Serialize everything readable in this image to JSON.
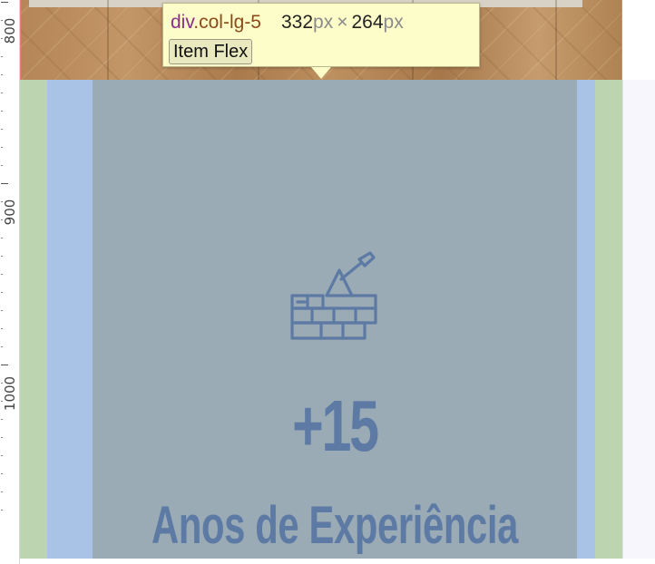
{
  "ruler": {
    "labels": [
      {
        "name": "ruler-label-800",
        "text": "800"
      },
      {
        "name": "ruler-label-900",
        "text": "900"
      },
      {
        "name": "ruler-label-1000",
        "text": "1000"
      }
    ]
  },
  "tooltip": {
    "tag": "div",
    "class_name": ".col-lg-5",
    "width_value": "332",
    "height_value": "264",
    "unit": "px",
    "times": "×",
    "badge": "Item Flex"
  },
  "stat": {
    "counter": "+15",
    "caption": "Anos de Experiência",
    "icon": "brick-wall-trowel-icon"
  },
  "colors": {
    "margin": "#bcd5b0",
    "padding": "#a8c3e6",
    "content": "#9aabb6",
    "text": "#5d7aa4",
    "tooltip_bg": "#fdfdc9"
  }
}
